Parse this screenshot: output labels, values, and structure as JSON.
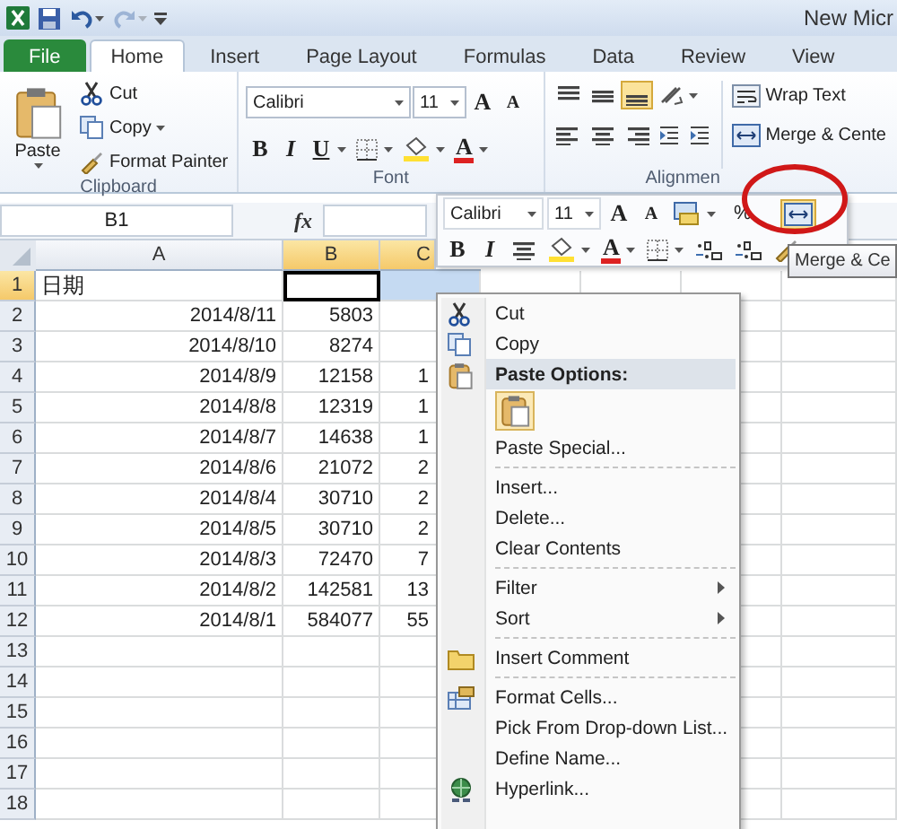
{
  "window": {
    "title": "New Micr"
  },
  "quick_access": [
    {
      "disabled": false
    },
    {
      "disabled": false
    },
    {
      "disabled": true
    }
  ],
  "tabs": [
    {
      "label": "File",
      "kind": "file",
      "selected": false
    },
    {
      "label": "Home",
      "kind": "tab",
      "selected": true
    },
    {
      "label": "Insert",
      "kind": "tab",
      "selected": false
    },
    {
      "label": "Page Layout",
      "kind": "tab",
      "selected": false
    },
    {
      "label": "Formulas",
      "kind": "tab",
      "selected": false
    },
    {
      "label": "Data",
      "kind": "tab",
      "selected": false
    },
    {
      "label": "Review",
      "kind": "tab",
      "selected": false
    },
    {
      "label": "View",
      "kind": "tab",
      "selected": false
    }
  ],
  "ribbon": {
    "clipboard": {
      "label": "Clipboard",
      "paste": "Paste",
      "buttons": [
        "Cut",
        "Copy",
        "Format Painter"
      ]
    },
    "font": {
      "label": "Font",
      "family": "Calibri",
      "size": "11",
      "grow": "A",
      "shrink": "A",
      "styles": [
        "B",
        "I",
        "U"
      ],
      "color_letter": "A"
    },
    "alignment": {
      "label": "Alignmen",
      "vertical": [
        {
          "selected": false
        },
        {
          "selected": false
        },
        {
          "selected": true
        }
      ],
      "wrap_text": "Wrap Text",
      "merge": "Merge & Cente"
    }
  },
  "formula_bar": {
    "name_box": "B1",
    "fx": "fx"
  },
  "sheet": {
    "columns": [
      {
        "label": "A",
        "selected": false
      },
      {
        "label": "B",
        "selected": true
      },
      {
        "label": "C",
        "selected": true
      }
    ],
    "rows": [
      {
        "number": "1",
        "selected": true,
        "a": "日期"
      },
      {
        "number": "2",
        "selected": false,
        "a": "2014/8/11",
        "b": "5803"
      },
      {
        "number": "3",
        "selected": false,
        "a": "2014/8/10",
        "b": "8274"
      },
      {
        "number": "4",
        "selected": false,
        "a": "2014/8/9",
        "b": "12158",
        "c": "1"
      },
      {
        "number": "5",
        "selected": false,
        "a": "2014/8/8",
        "b": "12319",
        "c": "1"
      },
      {
        "number": "6",
        "selected": false,
        "a": "2014/8/7",
        "b": "14638",
        "c": "1"
      },
      {
        "number": "7",
        "selected": false,
        "a": "2014/8/6",
        "b": "21072",
        "c": "2"
      },
      {
        "number": "8",
        "selected": false,
        "a": "2014/8/4",
        "b": "30710",
        "c": "2"
      },
      {
        "number": "9",
        "selected": false,
        "a": "2014/8/5",
        "b": "30710",
        "c": "2"
      },
      {
        "number": "10",
        "selected": false,
        "a": "2014/8/3",
        "b": "72470",
        "c": "7"
      },
      {
        "number": "11",
        "selected": false,
        "a": "2014/8/2",
        "b": "142581",
        "c": "13"
      },
      {
        "number": "12",
        "selected": false,
        "a": "2014/8/1",
        "b": "584077",
        "c": "55"
      },
      {
        "number": "13",
        "selected": false
      },
      {
        "number": "14",
        "selected": false
      },
      {
        "number": "15",
        "selected": false
      },
      {
        "number": "16",
        "selected": false
      },
      {
        "number": "17",
        "selected": false
      },
      {
        "number": "18",
        "selected": false
      }
    ]
  },
  "mini_toolbar": {
    "family": "Calibri",
    "size": "11",
    "grow": "A",
    "shrink": "A",
    "percent": "%",
    "merge_selected": true,
    "bold": "B",
    "italic": "I",
    "color_letter": "A"
  },
  "tooltip": "Merge & Ce",
  "context_menu": {
    "sections": [
      [
        {
          "kind": "item",
          "label": "Cut",
          "submenu": false
        },
        {
          "kind": "item",
          "label": "Copy",
          "submenu": false
        },
        {
          "kind": "header",
          "label": "Paste Options:"
        },
        {
          "kind": "paste-option"
        },
        {
          "kind": "item",
          "label": "Paste Special...",
          "submenu": false
        }
      ],
      [
        {
          "kind": "item",
          "label": "Insert...",
          "submenu": false
        },
        {
          "kind": "item",
          "label": "Delete...",
          "submenu": false
        },
        {
          "kind": "item",
          "label": "Clear Contents",
          "submenu": false
        }
      ],
      [
        {
          "kind": "item",
          "label": "Filter",
          "submenu": true
        },
        {
          "kind": "item",
          "label": "Sort",
          "submenu": true
        }
      ],
      [
        {
          "kind": "item",
          "label": "Insert Comment",
          "submenu": false
        }
      ],
      [
        {
          "kind": "item",
          "label": "Format Cells...",
          "submenu": false
        },
        {
          "kind": "item",
          "label": "Pick From Drop-down List...",
          "submenu": false
        },
        {
          "kind": "item",
          "label": "Define Name...",
          "submenu": false
        },
        {
          "kind": "item",
          "label": "Hyperlink...",
          "submenu": false
        }
      ]
    ]
  }
}
